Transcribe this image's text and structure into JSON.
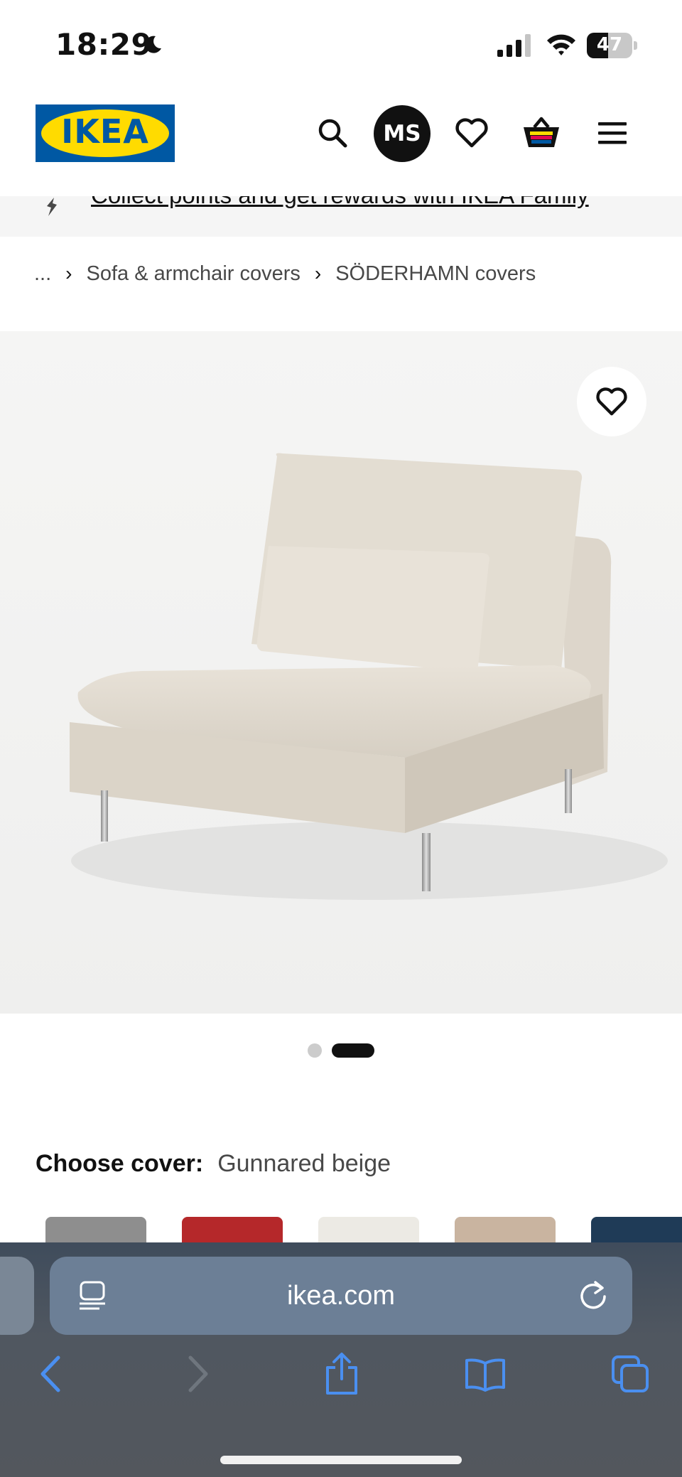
{
  "status_bar": {
    "time": "18:29",
    "battery_level": "47",
    "battery_fraction": 0.47,
    "icons": [
      "moon-icon",
      "cellular-signal-icon",
      "wifi-icon",
      "battery-icon"
    ]
  },
  "header": {
    "logo_text": "IKEA",
    "avatar_initials": "MS",
    "icons": [
      "search-icon",
      "heart-icon",
      "basket-icon",
      "menu-icon"
    ]
  },
  "banner": {
    "text": "Collect points and get rewards with IKEA Family"
  },
  "breadcrumb": {
    "ellipsis": "...",
    "items": [
      "Sofa & armchair covers",
      "SÖDERHAMN covers"
    ]
  },
  "gallery": {
    "image_alt": "SÖDERHAMN armchair section in Gunnared beige",
    "total_images": 2,
    "active_index": 1
  },
  "cover": {
    "label": "Choose cover:",
    "value": "Gunnared beige",
    "swatch_colors": [
      "#8e8e8e",
      "#b5282a",
      "#eceae4",
      "#c9b4a0",
      "#1f3b57"
    ]
  },
  "browser": {
    "url": "ikea.com",
    "icons": [
      "reader-icon",
      "reload-icon",
      "back-icon",
      "forward-icon",
      "share-icon",
      "bookmarks-icon",
      "tabs-icon"
    ]
  },
  "colors": {
    "ikea_blue": "#0058a3",
    "ikea_yellow": "#ffdb00",
    "safari_accent": "#4a8ff0"
  }
}
